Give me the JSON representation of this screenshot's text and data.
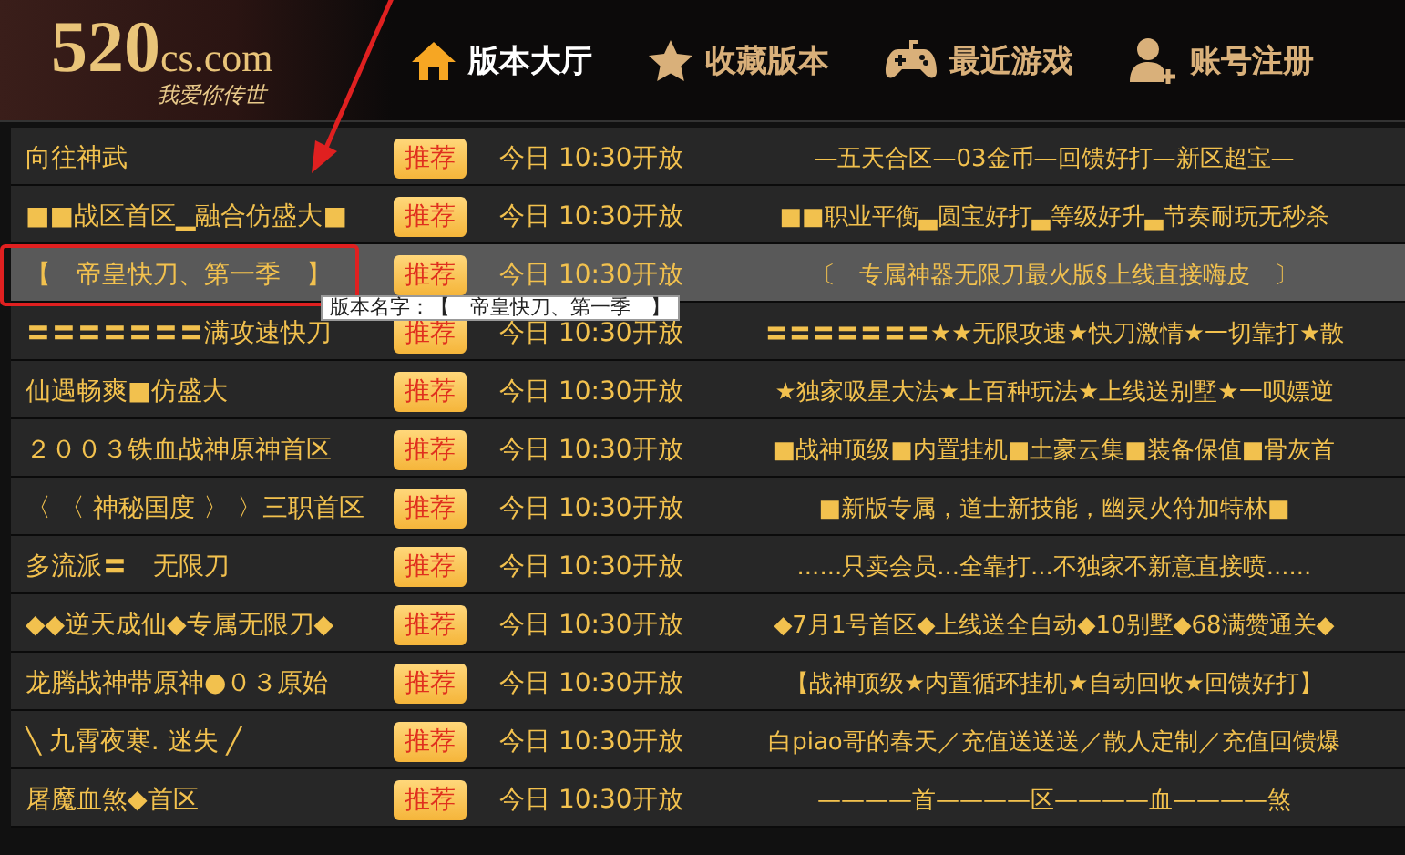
{
  "header": {
    "logo": {
      "number": "520",
      "domain": "cs.com",
      "tagline": "我爱你传世"
    },
    "nav": [
      {
        "label": "版本大厅",
        "selected": true
      },
      {
        "label": "收藏版本",
        "selected": false
      },
      {
        "label": "最近游戏",
        "selected": false
      },
      {
        "label": "账号注册",
        "selected": false
      }
    ]
  },
  "rows": [
    {
      "name": "向往神武",
      "badge": "推荐",
      "time": "今日 10:30开放",
      "description": "—五天合区—03金币—回馈好打—新区超宝—",
      "selected": false
    },
    {
      "name": "■■战区首区▁融合仿盛大■",
      "badge": "推荐",
      "time": "今日 10:30开放",
      "description": "■■职业平衡▃圆宝好打▃等级好升▃节奏耐玩无秒杀",
      "selected": false
    },
    {
      "name": "【　帝皇快刀、第一季　】",
      "badge": "推荐",
      "time": "今日 10:30开放",
      "description": "〔　专属神器无限刀最火版§上线直接嗨皮　〕",
      "selected": true
    },
    {
      "name": "〓〓〓〓〓〓〓满攻速快刀",
      "badge": "推荐",
      "time": "今日 10:30开放",
      "description": "〓〓〓〓〓〓〓★★无限攻速★快刀激情★一切靠打★散",
      "selected": false
    },
    {
      "name": "仙遇畅爽■仿盛大",
      "badge": "推荐",
      "time": "今日 10:30开放",
      "description": "★独家吸星大法★上百种玩法★上线送别墅★一呗嫖逆",
      "selected": false
    },
    {
      "name": "２００３铁血战神原神首区",
      "badge": "推荐",
      "time": "今日 10:30开放",
      "description": "■战神顶级■内置挂机■土豪云集■装备保值■骨灰首",
      "selected": false
    },
    {
      "name": "〈 〈 神秘国度 〉 〉三职首区",
      "badge": "推荐",
      "time": "今日 10:30开放",
      "description": "■新版专属，道士新技能，幽灵火符加特林■",
      "selected": false
    },
    {
      "name": "多流派〓　无限刀",
      "badge": "推荐",
      "time": "今日 10:30开放",
      "description": "......只卖会员...全靠打...不独家不新意直接喷......",
      "selected": false
    },
    {
      "name": "◆◆逆天成仙◆专属无限刀◆",
      "badge": "推荐",
      "time": "今日 10:30开放",
      "description": "◆7月1号首区◆上线送全自动◆10别墅◆68满赞通关◆",
      "selected": false
    },
    {
      "name": "龙腾战神带原神●０３原始",
      "badge": "推荐",
      "time": "今日 10:30开放",
      "description": "【战神顶级★内置循环挂机★自动回收★回馈好打】",
      "selected": false
    },
    {
      "name": "╲ 九霄夜寒. 迷失 ╱",
      "badge": "推荐",
      "time": "今日 10:30开放",
      "description": "白piao哥的春天／充值送送送／散人定制／充值回馈爆",
      "selected": false
    },
    {
      "name": "屠魔血煞◆首区",
      "badge": "推荐",
      "time": "今日 10:30开放",
      "description": "————首————区————血————煞",
      "selected": false
    }
  ],
  "tooltip": {
    "text": "版本名字：【　帝皇快刀、第一季　】"
  }
}
